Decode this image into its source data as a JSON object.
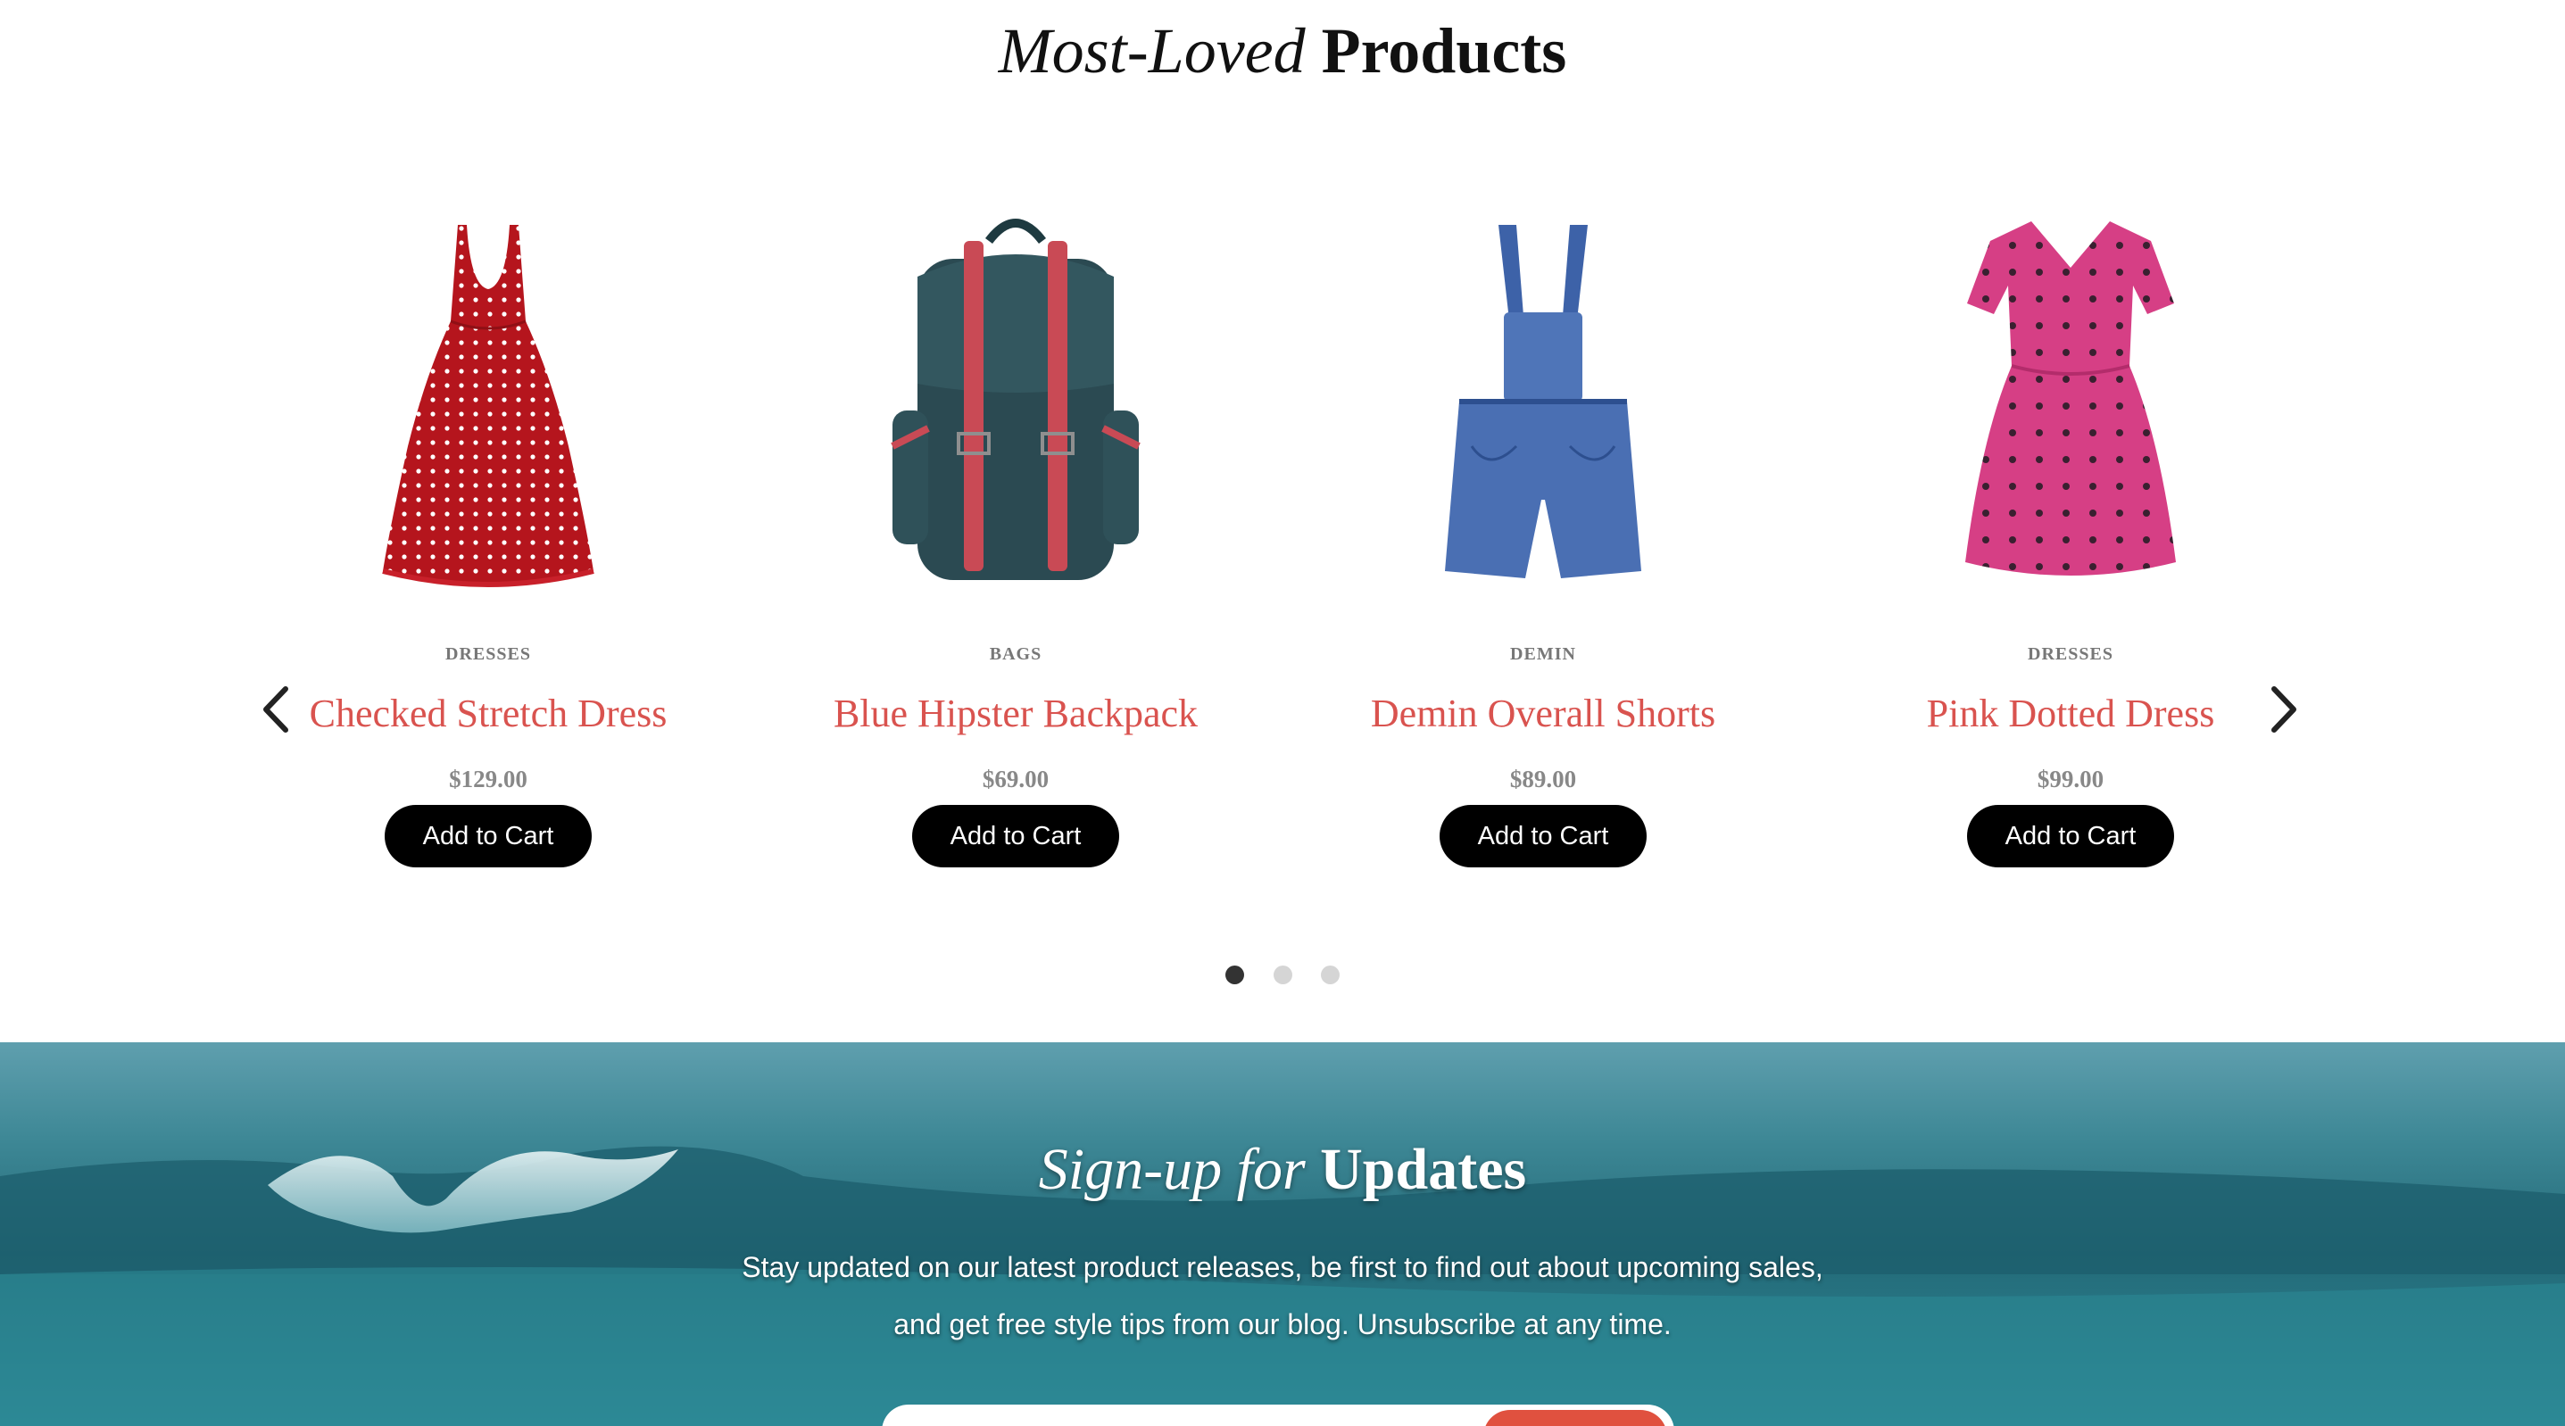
{
  "products_section": {
    "title_italic": "Most-Loved",
    "title_bold": "Products",
    "items": [
      {
        "category": "DRESSES",
        "name": "Checked Stretch Dress",
        "price": "$129.00",
        "button": "Add to Cart",
        "image": "red-polka-dress"
      },
      {
        "category": "BAGS",
        "name": "Blue Hipster Backpack",
        "price": "$69.00",
        "button": "Add to Cart",
        "image": "teal-backpack"
      },
      {
        "category": "DEMIN",
        "name": "Demin Overall Shorts",
        "price": "$89.00",
        "button": "Add to Cart",
        "image": "denim-overall-shorts"
      },
      {
        "category": "DRESSES",
        "name": "Pink Dotted Dress",
        "price": "$99.00",
        "button": "Add to Cart",
        "image": "pink-dotted-dress"
      }
    ],
    "pagination": {
      "pages": 3,
      "active": 1
    }
  },
  "signup_section": {
    "title_italic": "Sign-up for",
    "title_bold": "Updates",
    "text_line1": "Stay updated on our latest product releases, be first to find out about upcoming sales,",
    "text_line2": "and get free style tips from our blog. Unsubscribe at any time.",
    "email_placeholder": "",
    "background": "ocean-wave"
  },
  "colors": {
    "accent": "#d9534f",
    "button_bg": "#000000",
    "submit_bg": "#e0513f",
    "ocean": "#2f7f8c"
  },
  "icons": {
    "prev": "chevron-left-icon",
    "next": "chevron-right-icon"
  }
}
